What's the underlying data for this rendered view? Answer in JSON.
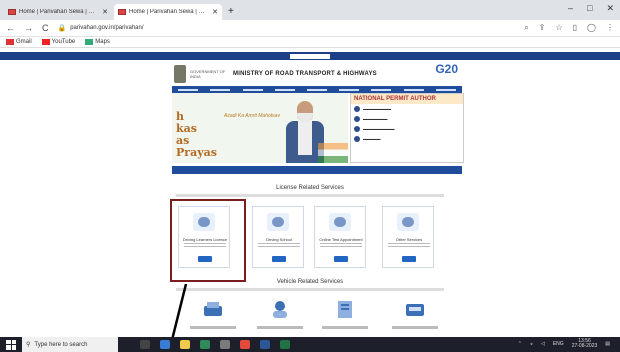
{
  "browser": {
    "tabs": [
      {
        "title": "Home | Parivahan Sewa | Ministr",
        "active": false
      },
      {
        "title": "Home | Parivahan Sewa | Ministr",
        "active": true
      }
    ],
    "new_tab": "+",
    "window_controls": [
      "–",
      "□",
      "✕"
    ],
    "nav": {
      "back": "←",
      "forward": "→",
      "reload": "C"
    },
    "url": "parivahan.gov.in/parivahan/",
    "bookmarks": [
      {
        "label": "Gmail",
        "kind": "gmail"
      },
      {
        "label": "YouTube",
        "kind": "yt"
      },
      {
        "label": "Maps",
        "kind": "maps"
      }
    ]
  },
  "site": {
    "gov_label": "GOVERNMENT OF INDIA",
    "ministry": "MINISTRY OF ROAD TRANSPORT & HIGHWAYS",
    "g20": "G20",
    "banner_text": [
      "h",
      "kas",
      "as",
      "Prayas"
    ],
    "azadi": "Azadi Ka Amrit Mahotsav",
    "npa_title": "NATIONAL PERMIT AUTHOR",
    "license_title": "License Related Services",
    "vehicle_title": "Vehicle Related Services",
    "license_cards": [
      {
        "label": "Driving Learners Licence"
      },
      {
        "label": "Driving School"
      },
      {
        "label": "Online Test Appointment"
      },
      {
        "label": "Other Services"
      }
    ]
  },
  "taskbar": {
    "search_placeholder": "Type here to search",
    "time": "13:56",
    "date": "27-08-2023",
    "lang": "ENG"
  }
}
